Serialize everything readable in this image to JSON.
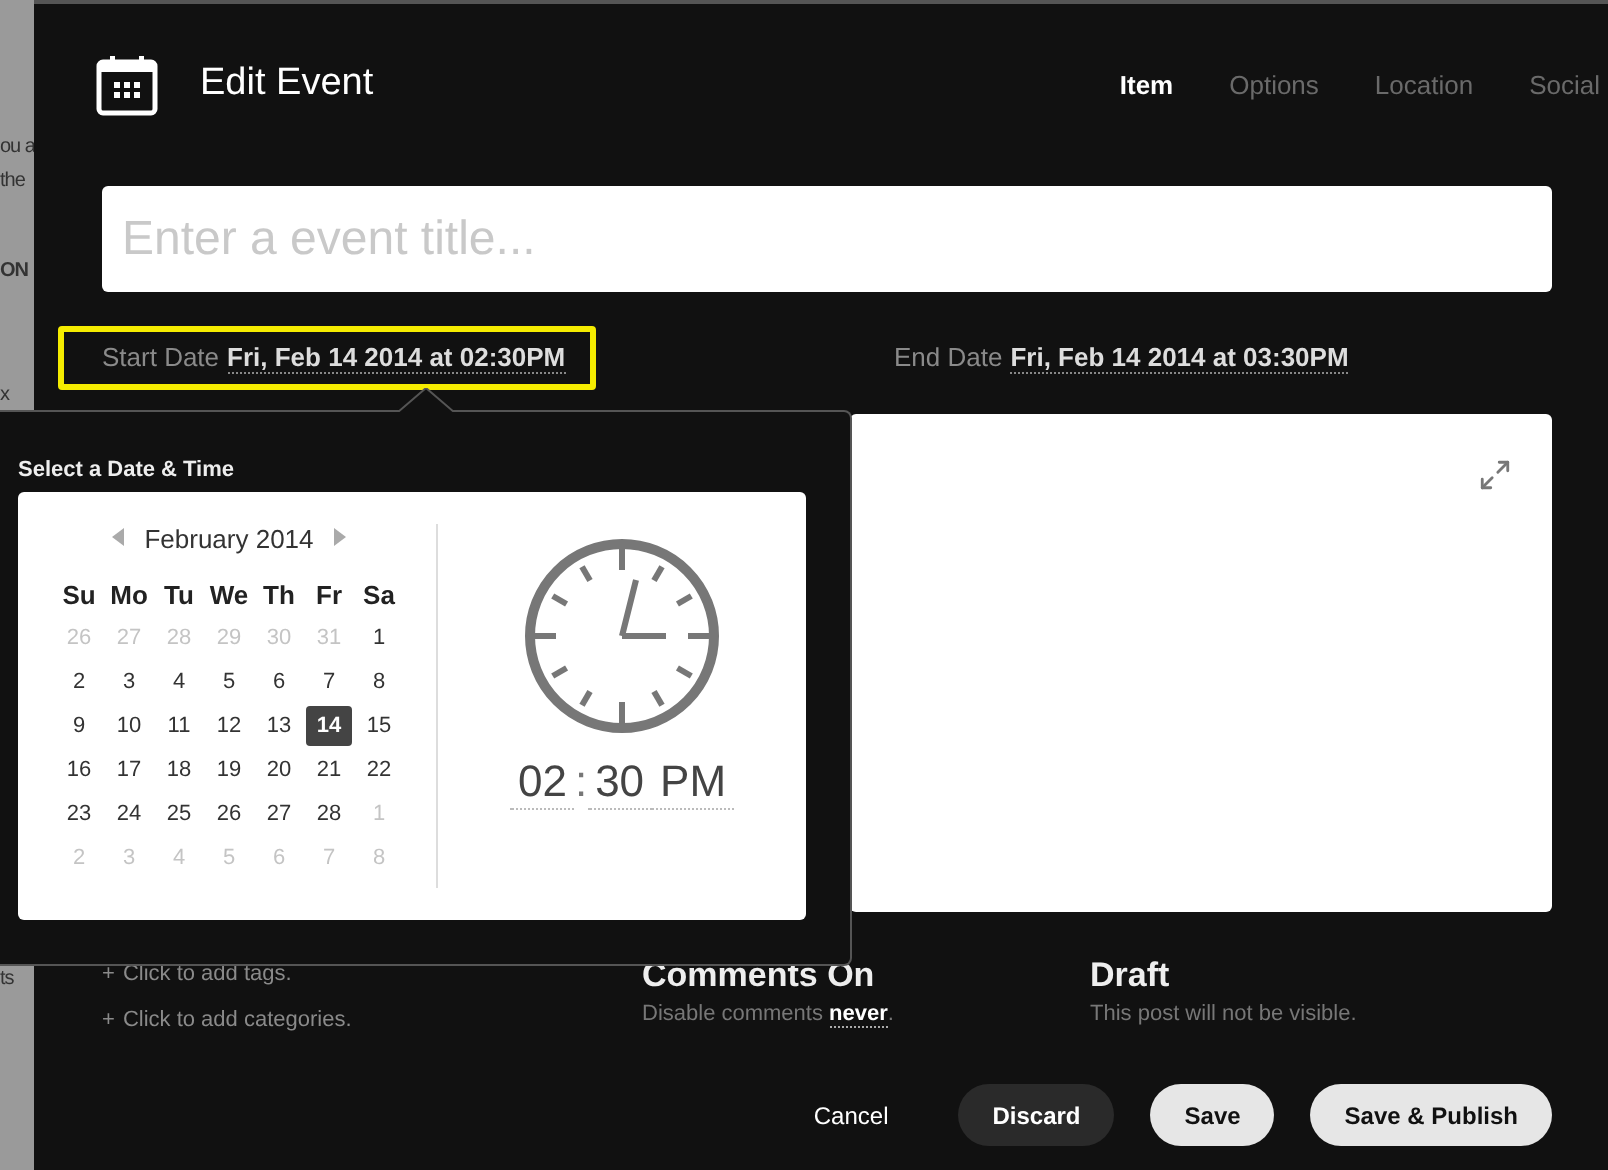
{
  "background_page": {
    "fragments": [
      "ou a",
      "the",
      "ON",
      "x",
      "ts"
    ]
  },
  "dialog": {
    "title": "Edit Event",
    "tabs": [
      {
        "label": "Item",
        "selected": true
      },
      {
        "label": "Options",
        "selected": false
      },
      {
        "label": "Location",
        "selected": false
      },
      {
        "label": "Social",
        "selected": false
      }
    ],
    "title_field": {
      "placeholder": "Enter a event title..."
    },
    "start_date": {
      "label": "Start Date",
      "value": "Fri, Feb 14 2014 at 02:30PM",
      "highlighted": true
    },
    "end_date": {
      "label": "End Date",
      "value": "Fri, Feb 14 2014 at 03:30PM",
      "highlighted": false
    },
    "links": [
      {
        "icon": "+",
        "text": "Click to add tags."
      },
      {
        "icon": "+",
        "text": "Click to add categories."
      }
    ],
    "comments": {
      "title": "Comments On",
      "text": "Disable comments",
      "link": "never",
      "end": "."
    },
    "status": {
      "title": "Draft",
      "text": "This post will not be visible."
    },
    "buttons": [
      {
        "label": "Cancel",
        "kind": "plain"
      },
      {
        "label": "Discard",
        "kind": "dark"
      },
      {
        "label": "Save",
        "kind": "light"
      },
      {
        "label": "Save & Publish",
        "kind": "light"
      }
    ]
  },
  "picker": {
    "title": "Select a Date & Time",
    "month": "February 2014",
    "weekdays": [
      "Su",
      "Mo",
      "Tu",
      "We",
      "Th",
      "Fr",
      "Sa"
    ],
    "weeks": [
      [
        {
          "day": "26",
          "other_month": true,
          "selected": false
        },
        {
          "day": "27",
          "other_month": true,
          "selected": false
        },
        {
          "day": "28",
          "other_month": true,
          "selected": false
        },
        {
          "day": "29",
          "other_month": true,
          "selected": false
        },
        {
          "day": "30",
          "other_month": true,
          "selected": false
        },
        {
          "day": "31",
          "other_month": true,
          "selected": false
        },
        {
          "day": "1",
          "other_month": false,
          "selected": false
        }
      ],
      [
        {
          "day": "2",
          "other_month": false,
          "selected": false
        },
        {
          "day": "3",
          "other_month": false,
          "selected": false
        },
        {
          "day": "4",
          "other_month": false,
          "selected": false
        },
        {
          "day": "5",
          "other_month": false,
          "selected": false
        },
        {
          "day": "6",
          "other_month": false,
          "selected": false
        },
        {
          "day": "7",
          "other_month": false,
          "selected": false
        },
        {
          "day": "8",
          "other_month": false,
          "selected": false
        }
      ],
      [
        {
          "day": "9",
          "other_month": false,
          "selected": false
        },
        {
          "day": "10",
          "other_month": false,
          "selected": false
        },
        {
          "day": "11",
          "other_month": false,
          "selected": false
        },
        {
          "day": "12",
          "other_month": false,
          "selected": false
        },
        {
          "day": "13",
          "other_month": false,
          "selected": false
        },
        {
          "day": "14",
          "other_month": false,
          "selected": true
        },
        {
          "day": "15",
          "other_month": false,
          "selected": false
        }
      ],
      [
        {
          "day": "16",
          "other_month": false,
          "selected": false
        },
        {
          "day": "17",
          "other_month": false,
          "selected": false
        },
        {
          "day": "18",
          "other_month": false,
          "selected": false
        },
        {
          "day": "19",
          "other_month": false,
          "selected": false
        },
        {
          "day": "20",
          "other_month": false,
          "selected": false
        },
        {
          "day": "21",
          "other_month": false,
          "selected": false
        },
        {
          "day": "22",
          "other_month": false,
          "selected": false
        }
      ],
      [
        {
          "day": "23",
          "other_month": false,
          "selected": false
        },
        {
          "day": "24",
          "other_month": false,
          "selected": false
        },
        {
          "day": "25",
          "other_month": false,
          "selected": false
        },
        {
          "day": "26",
          "other_month": false,
          "selected": false
        },
        {
          "day": "27",
          "other_month": false,
          "selected": false
        },
        {
          "day": "28",
          "other_month": false,
          "selected": false
        },
        {
          "day": "1",
          "other_month": true,
          "selected": false
        }
      ],
      [
        {
          "day": "2",
          "other_month": true,
          "selected": false
        },
        {
          "day": "3",
          "other_month": true,
          "selected": false
        },
        {
          "day": "4",
          "other_month": true,
          "selected": false
        },
        {
          "day": "5",
          "other_month": true,
          "selected": false
        },
        {
          "day": "6",
          "other_month": true,
          "selected": false
        },
        {
          "day": "7",
          "other_month": true,
          "selected": false
        },
        {
          "day": "8",
          "other_month": true,
          "selected": false
        }
      ]
    ],
    "time": {
      "hour": "02",
      "separator": ":",
      "minute": "30",
      "period": "PM"
    }
  }
}
